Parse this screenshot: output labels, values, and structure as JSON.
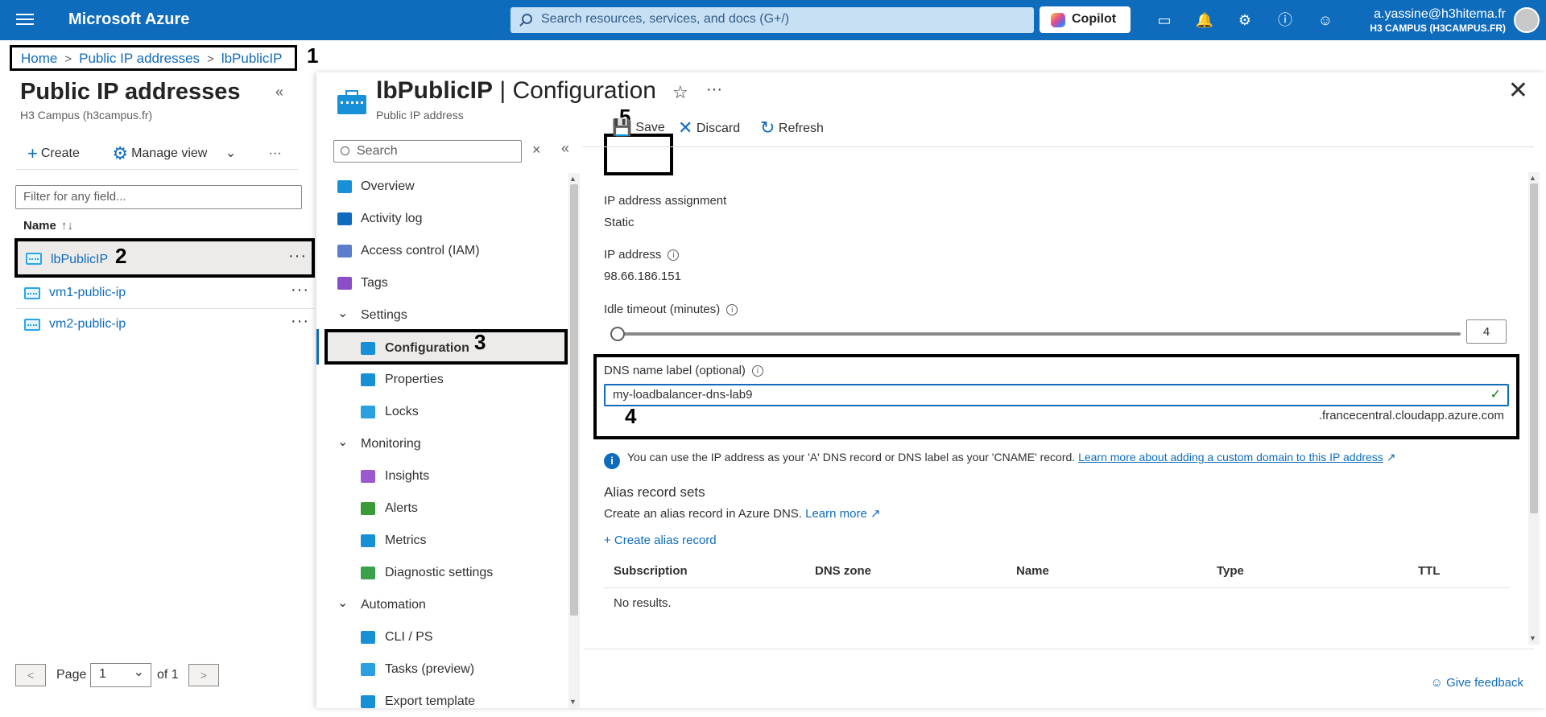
{
  "topbar": {
    "brand": "Microsoft Azure",
    "search_placeholder": "Search resources, services, and docs (G+/)",
    "copilot": "Copilot",
    "user_email": "a.yassine@h3hitema.fr",
    "user_tenant": "H3 CAMPUS (H3CAMPUS.FR)"
  },
  "breadcrumb": [
    "Home",
    "Public IP addresses",
    "lbPublicIP"
  ],
  "annotations": [
    "1",
    "2",
    "3",
    "4",
    "5"
  ],
  "left": {
    "title": "Public IP addresses",
    "subtitle": "H3 Campus (h3campus.fr)",
    "create": "Create",
    "manage_view": "Manage view",
    "filter_placeholder": "Filter for any field...",
    "col_name": "Name",
    "rows": [
      "lbPublicIP",
      "vm1-public-ip",
      "vm2-public-ip"
    ],
    "pager": {
      "label": "Page",
      "value": "1",
      "of": "of 1"
    }
  },
  "blade": {
    "name": "lbPublicIP",
    "section": " | Configuration",
    "type": "Public IP address",
    "menu_search": "Search",
    "menu": [
      {
        "label": "Overview",
        "icon": "overview-icon",
        "color": "#1890d8"
      },
      {
        "label": "Activity log",
        "icon": "activity-log-icon",
        "color": "#0f6cbd"
      },
      {
        "label": "Access control (IAM)",
        "icon": "iam-icon",
        "color": "#5c7ccc"
      },
      {
        "label": "Tags",
        "icon": "tag-icon",
        "color": "#8a4fc8"
      },
      {
        "label": "Settings",
        "group": true
      },
      {
        "label": "Configuration",
        "icon": "configuration-icon",
        "color": "#1890d8",
        "active": true
      },
      {
        "label": "Properties",
        "icon": "properties-icon",
        "color": "#1890d8"
      },
      {
        "label": "Locks",
        "icon": "lock-icon",
        "color": "#2aa0e0"
      },
      {
        "label": "Monitoring",
        "group": true
      },
      {
        "label": "Insights",
        "icon": "insights-icon",
        "color": "#9b59d0"
      },
      {
        "label": "Alerts",
        "icon": "alert-icon",
        "color": "#3a9a3a"
      },
      {
        "label": "Metrics",
        "icon": "metrics-icon",
        "color": "#1890d8"
      },
      {
        "label": "Diagnostic settings",
        "icon": "diagnostic-icon",
        "color": "#3aa04a"
      },
      {
        "label": "Automation",
        "group": true
      },
      {
        "label": "CLI / PS",
        "icon": "cli-icon",
        "color": "#1890d8"
      },
      {
        "label": "Tasks (preview)",
        "icon": "tasks-icon",
        "color": "#2aa0e0"
      },
      {
        "label": "Export template",
        "icon": "export-icon",
        "color": "#1890d8"
      }
    ],
    "commands": {
      "save": "Save",
      "discard": "Discard",
      "refresh": "Refresh"
    },
    "form": {
      "assignment_label": "IP address assignment",
      "assignment_value": "Static",
      "ip_label": "IP address",
      "ip_value": "98.66.186.151",
      "idle_label": "Idle timeout (minutes)",
      "idle_value": "4",
      "idle_fraction": 0.0,
      "dns_label": "DNS name label (optional)",
      "dns_value": "my-loadbalancer-dns-lab9",
      "dns_suffix": ".francecentral.cloudapp.azure.com",
      "info_text": "You can use the IP address as your 'A' DNS record or DNS label as your 'CNAME' record.",
      "info_link": "Learn more about adding a custom domain to this IP address",
      "alias_title": "Alias record sets",
      "alias_desc": "Create an alias record in Azure DNS.",
      "learn_more": "Learn more",
      "create_alias": "+ Create alias record",
      "table_headers": [
        "Subscription",
        "DNS zone",
        "Name",
        "Type",
        "TTL"
      ],
      "no_results": "No results."
    },
    "feedback": "Give feedback"
  }
}
